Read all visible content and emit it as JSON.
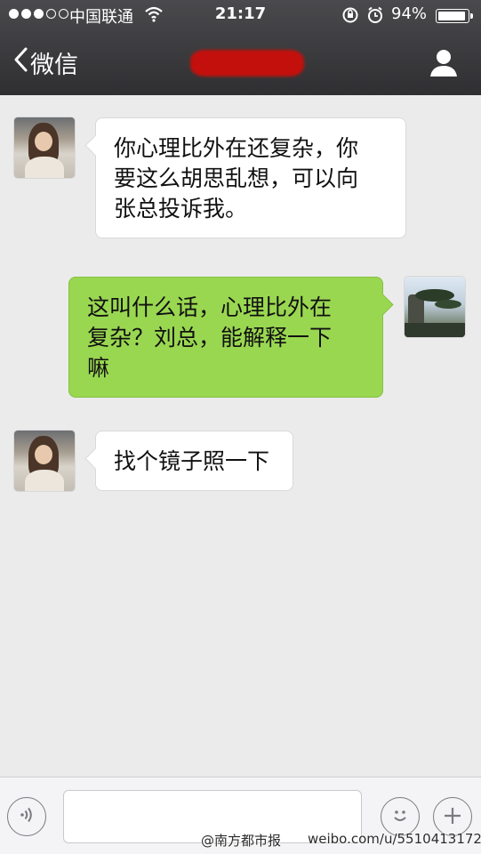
{
  "status_bar": {
    "signal_dots_filled": 3,
    "signal_dots_total": 5,
    "carrier": "中国联通",
    "time": "21:17",
    "battery_percent": "94%",
    "battery_level": 0.94
  },
  "nav": {
    "back_label": "微信",
    "title_redacted": true
  },
  "messages": [
    {
      "direction": "incoming",
      "text": "你心理比外在还复杂，你\n要这么胡思乱想，可以向\n张总投诉我。"
    },
    {
      "direction": "outgoing",
      "text": "这叫什么话，心理比外在\n复杂？刘总，能解释一下\n嘛"
    },
    {
      "direction": "incoming",
      "text": "找个镜子照一下"
    }
  ],
  "input_bar": {
    "text_value": ""
  },
  "watermarks": {
    "left": "@南方都市报",
    "right": "weibo.com/u/5510413172"
  },
  "colors": {
    "nav_bg": "#38383b",
    "chat_bg": "#ebebeb",
    "incoming_bubble": "#ffffff",
    "outgoing_bubble": "#9ad751",
    "redaction": "#c4100c"
  }
}
